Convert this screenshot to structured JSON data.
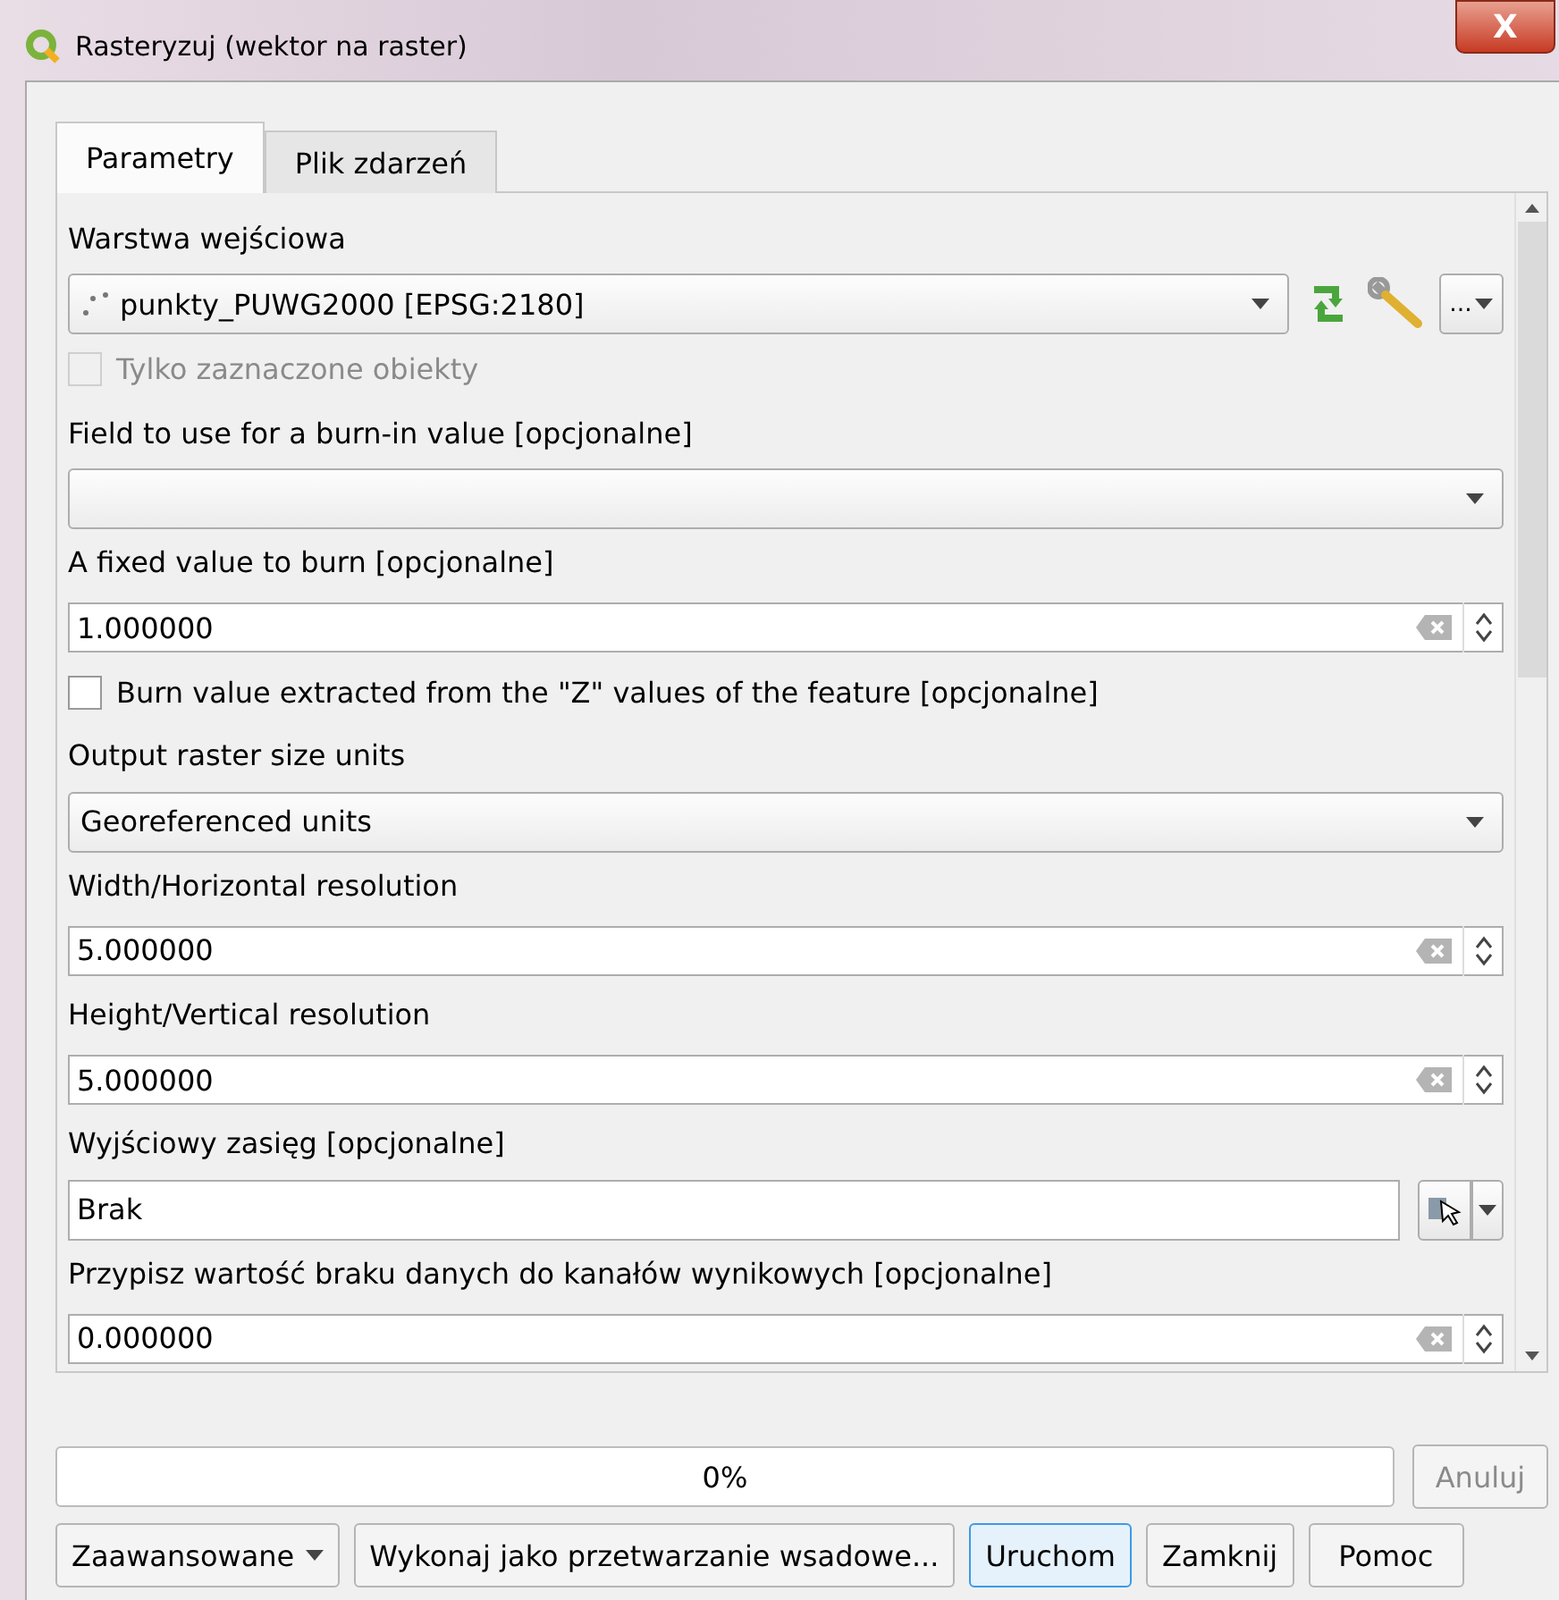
{
  "window": {
    "title": "Rasteryzuj (wektor na raster)",
    "close": "X"
  },
  "tabs": [
    {
      "label": "Parametry",
      "selected": true
    },
    {
      "label": "Plik zdarzeń",
      "selected": false
    }
  ],
  "parameters": [
    {
      "kind": "layer",
      "label": "Warstwa wejściowa",
      "value": "punkty_PUWG2000 [EPSG:2180]",
      "more": "..."
    },
    {
      "kind": "checkbox",
      "label": "Tylko zaznaczone obiekty",
      "checked": false,
      "disabled": true
    },
    {
      "kind": "combo",
      "label": "Field to use for a burn-in value [opcjonalne]"
    },
    {
      "kind": "number",
      "label": "A fixed value to burn [opcjonalne]",
      "value": "1.000000"
    },
    {
      "kind": "checkbox",
      "label": "Burn value extracted from the \"Z\" values of the feature [opcjonalne]",
      "checked": false,
      "disabled": false
    },
    {
      "kind": "combo",
      "label": "Output raster size units",
      "value": "Georeferenced units"
    },
    {
      "kind": "number",
      "label": "Width/Horizontal resolution",
      "value": "5.000000"
    },
    {
      "kind": "number",
      "label": "Height/Vertical resolution",
      "value": "5.000000"
    },
    {
      "kind": "extent",
      "label": "Wyjściowy zasięg [opcjonalne]",
      "value": "Brak"
    },
    {
      "kind": "number",
      "label": "Przypisz wartość braku danych do kanałów wynikowych [opcjonalne]",
      "value": "0.000000"
    }
  ],
  "progress": {
    "level": 0,
    "reading": "0%"
  },
  "cancel": {
    "label": "Anuluj",
    "disabled": true
  },
  "buttons": [
    {
      "kind": "menu",
      "label": "Zaawansowane"
    },
    {
      "kind": "plain",
      "label": "Wykonaj jako przetwarzanie wsadowe..."
    },
    {
      "kind": "default",
      "label": "Uruchom"
    },
    {
      "kind": "plain",
      "label": "Zamknij"
    },
    {
      "kind": "plain",
      "label": "Pomoc"
    }
  ]
}
